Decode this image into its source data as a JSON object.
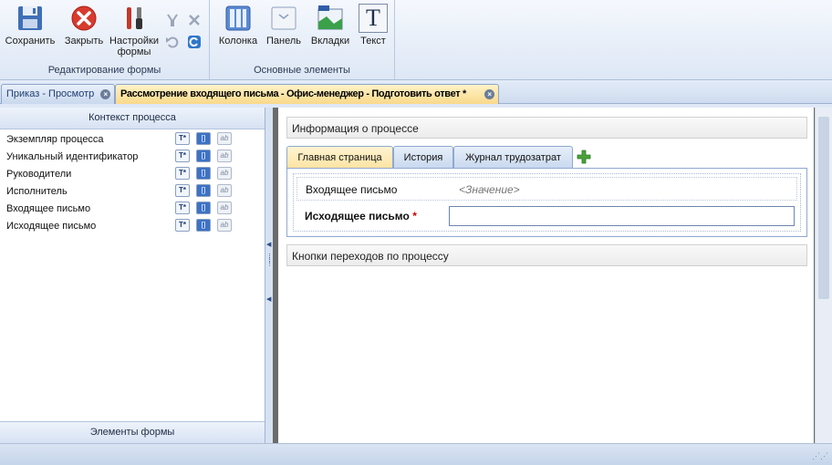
{
  "ribbon": {
    "groups": [
      {
        "title": "Редактирование формы"
      },
      {
        "title": "Основные элементы"
      }
    ],
    "save_label": "Сохранить",
    "close_label": "Закрыть",
    "settings_label_1": "Настройки",
    "settings_label_2": "формы",
    "column_label": "Колонка",
    "panel_label": "Панель",
    "tabs_label": "Вкладки",
    "text_label": "Текст",
    "text_icon_glyph": "T"
  },
  "doc_tabs": [
    {
      "label": "Приказ - Просмотр",
      "active": false
    },
    {
      "label": "Рассмотрение входящего письма - Офис-менеджер - Подготовить ответ *",
      "active": true
    }
  ],
  "left_panel": {
    "header": "Контекст процесса",
    "footer": "Элементы формы",
    "badges": {
      "t": "T*",
      "c": "[]",
      "ab": "ab"
    },
    "items": [
      {
        "label": "Экземпляр процесса"
      },
      {
        "label": "Уникальный идентификатор"
      },
      {
        "label": "Руководители"
      },
      {
        "label": "Исполнитель"
      },
      {
        "label": "Входящее письмо"
      },
      {
        "label": "Исходящее письмо"
      }
    ]
  },
  "form": {
    "section_info": "Информация о процессе",
    "tabs": [
      {
        "label": "Главная страница",
        "active": true
      },
      {
        "label": "История",
        "active": false
      },
      {
        "label": "Журнал трудозатрат",
        "active": false
      }
    ],
    "incoming_label": "Входящее письмо",
    "incoming_value": "<Значение>",
    "outgoing_label": "Исходящее письмо",
    "required_mark": "*",
    "outgoing_value": "",
    "section_buttons": "Кнопки переходов по процессу"
  },
  "colors": {
    "ribbon_bg": "#dde7f5",
    "active_tab": "#f9d98a",
    "required": "#cc0000"
  }
}
